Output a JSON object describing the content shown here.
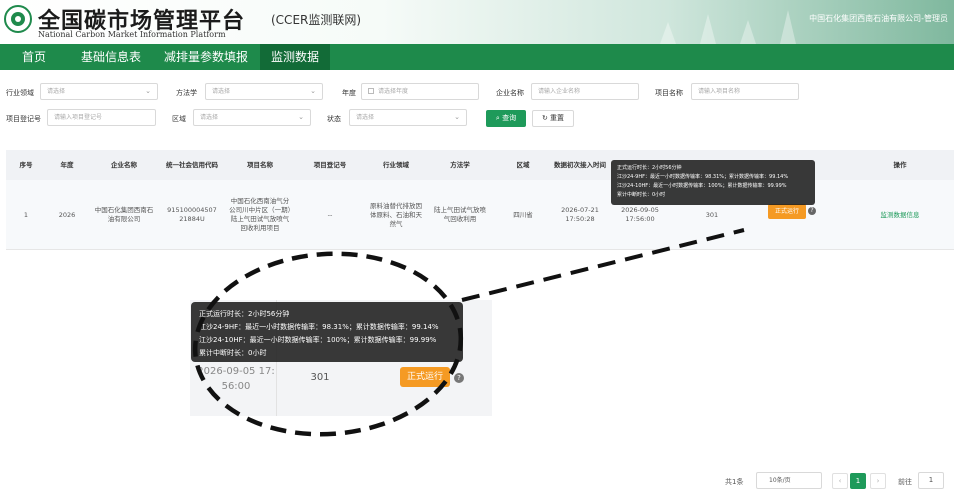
{
  "header": {
    "title": "全国碳市场管理平台",
    "subtitle": "(CCER监测联网)",
    "title_en": "National Carbon Market Information Platform",
    "user": "中国石化集团西南石油有限公司-管理员"
  },
  "nav": {
    "items": [
      "首页",
      "基础信息表",
      "减排量参数填报",
      "监测数据"
    ],
    "active": "监测数据"
  },
  "filters": {
    "industry": {
      "label": "行业领域",
      "placeholder": "请选择"
    },
    "method": {
      "label": "方法学",
      "placeholder": "请选择"
    },
    "year": {
      "label": "年度",
      "placeholder": "请选择年度"
    },
    "company": {
      "label": "企业名称",
      "placeholder": "请输入企业名称"
    },
    "project_name": {
      "label": "项目名称",
      "placeholder": "请输入项目名称"
    },
    "reg_no": {
      "label": "项目登记号",
      "placeholder": "请输入项目登记号"
    },
    "region": {
      "label": "区域",
      "placeholder": "请选择"
    },
    "status": {
      "label": "状态",
      "placeholder": "请选择"
    },
    "query_label": "查询",
    "reset_label": "重置"
  },
  "table": {
    "headers": [
      "序号",
      "年度",
      "企业名称",
      "统一社会信用代码",
      "项目名称",
      "项目登记号",
      "行业领域",
      "方法学",
      "区域",
      "数据初次接入时间",
      "数据最新接入时间",
      "",
      "",
      "操作"
    ],
    "row": {
      "index": "1",
      "year": "2026",
      "company": "中国石化集团西南石油有限公司",
      "credit_code": "91510000450721884U",
      "project": "中国石化西南油气分公司川中片区（一期）陆上气田试气放喷气回收利用项目",
      "reg_no": "--",
      "industry": "原料油替代排放因体原料、石油和天然气",
      "method": "陆上气田试气放喷气回收利用",
      "region": "四川省",
      "first_time": "2026-07-21 17:50:28",
      "latest_time": "2026-09-05 17:56:00",
      "count": "301",
      "status": "正式运行",
      "action": "监测数据信息"
    }
  },
  "tooltip": {
    "line1": "正式运行时长：2小时56分钟",
    "line2": "江沙24-9HF：最近一小时数据传输率：98.31%；累计数据传输率：99.14%",
    "line3": "江沙24-10HF：最近一小时数据传输率：100%；累计数据传输率：99.99%",
    "line4": "累计中断时长：0小时"
  },
  "zoom": {
    "header_partial": "数据最新接入时",
    "line1": "正式运行时长：2小时56分钟",
    "date_line1": "2026-09-05 17:",
    "date_line2": "56:00",
    "count": "301",
    "status": "正式运行"
  },
  "pagination": {
    "total": "共1条",
    "page_size": "10条/页",
    "prev": "‹",
    "current": "1",
    "next": "›",
    "goto": "前往",
    "page_input": "1"
  }
}
